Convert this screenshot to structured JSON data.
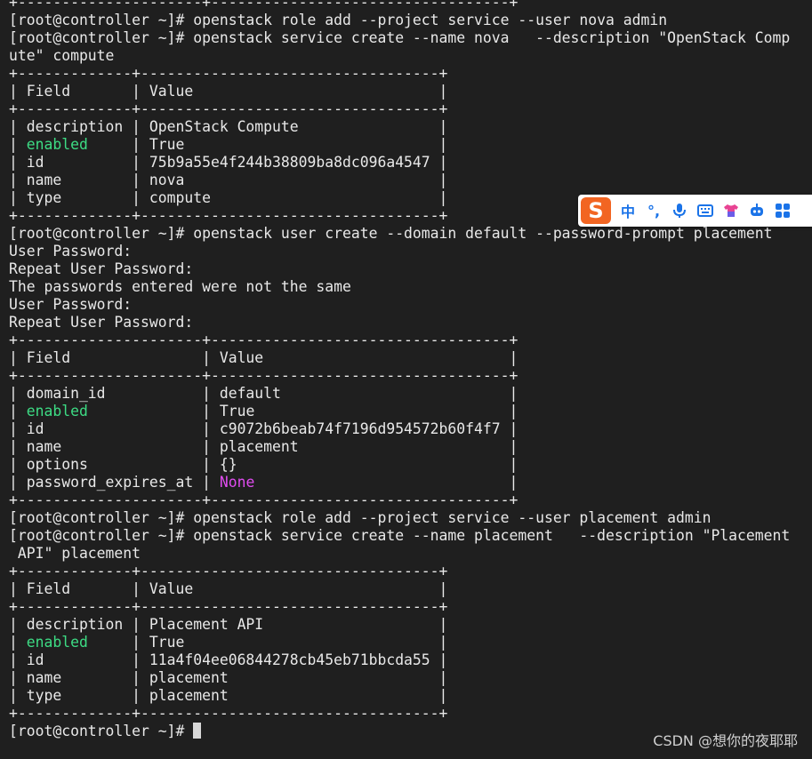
{
  "terminal": {
    "lines": [
      [
        {
          "t": "+---------------------+----------------------------------+"
        }
      ],
      [
        {
          "t": "[root@controller ~]# openstack role add --project service --user nova admin"
        }
      ],
      [
        {
          "t": "[root@controller ~]# openstack service create --name nova   --description \"OpenStack Comp"
        }
      ],
      [
        {
          "t": "ute\" compute"
        }
      ],
      [
        {
          "t": "+-------------+----------------------------------+"
        }
      ],
      [
        {
          "t": "| Field       | Value                            |"
        }
      ],
      [
        {
          "t": "+-------------+----------------------------------+"
        }
      ],
      [
        {
          "t": "| description | OpenStack Compute                |"
        }
      ],
      [
        {
          "t": "| "
        },
        {
          "t": "enabled",
          "c": "green"
        },
        {
          "t": "     | True                             |"
        }
      ],
      [
        {
          "t": "| id          | 75b9a55e4f244b38809ba8dc096a4547 |"
        }
      ],
      [
        {
          "t": "| name        | nova                             |"
        }
      ],
      [
        {
          "t": "| type        | compute                          |"
        }
      ],
      [
        {
          "t": "+-------------+----------------------------------+"
        }
      ],
      [
        {
          "t": "[root@controller ~]# openstack user create --domain default --password-prompt placement"
        }
      ],
      [
        {
          "t": "User Password:"
        }
      ],
      [
        {
          "t": "Repeat User Password:"
        }
      ],
      [
        {
          "t": "The passwords entered were not the same"
        }
      ],
      [
        {
          "t": "User Password:"
        }
      ],
      [
        {
          "t": "Repeat User Password:"
        }
      ],
      [
        {
          "t": "+---------------------+----------------------------------+"
        }
      ],
      [
        {
          "t": "| Field               | Value                            |"
        }
      ],
      [
        {
          "t": "+---------------------+----------------------------------+"
        }
      ],
      [
        {
          "t": "| domain_id           | default                          |"
        }
      ],
      [
        {
          "t": "| "
        },
        {
          "t": "enabled",
          "c": "green"
        },
        {
          "t": "             | True                             |"
        }
      ],
      [
        {
          "t": "| id                  | c9072b6beab74f7196d954572b60f4f7 |"
        }
      ],
      [
        {
          "t": "| name                | placement                        |"
        }
      ],
      [
        {
          "t": "| options             | {}                               |"
        }
      ],
      [
        {
          "t": "| password_expires_at | "
        },
        {
          "t": "None",
          "c": "magenta"
        },
        {
          "t": "                             |"
        }
      ],
      [
        {
          "t": "+---------------------+----------------------------------+"
        }
      ],
      [
        {
          "t": "[root@controller ~]# openstack role add --project service --user placement admin"
        }
      ],
      [
        {
          "t": "[root@controller ~]# openstack service create --name placement   --description \"Placement"
        }
      ],
      [
        {
          "t": " API\" placement"
        }
      ],
      [
        {
          "t": "+-------------+----------------------------------+"
        }
      ],
      [
        {
          "t": "| Field       | Value                            |"
        }
      ],
      [
        {
          "t": "+-------------+----------------------------------+"
        }
      ],
      [
        {
          "t": "| description | Placement API                    |"
        }
      ],
      [
        {
          "t": "| "
        },
        {
          "t": "enabled",
          "c": "green"
        },
        {
          "t": "     | True                             |"
        }
      ],
      [
        {
          "t": "| id          | 11a4f04ee06844278cb45eb71bbcda55 |"
        }
      ],
      [
        {
          "t": "| name        | placement                        |"
        }
      ],
      [
        {
          "t": "| type        | placement                        |"
        }
      ],
      [
        {
          "t": "+-------------+----------------------------------+"
        }
      ],
      [
        {
          "t": "[root@controller ~]# "
        }
      ]
    ]
  },
  "ime_toolbar": {
    "logo_letter": "S",
    "items": [
      {
        "label": "中",
        "name": "chinese-mode-toggle"
      },
      {
        "label": "°,",
        "name": "punctuation-toggle"
      },
      {
        "icon": "microphone-icon"
      },
      {
        "icon": "keyboard-icon"
      },
      {
        "icon": "skin-icon"
      },
      {
        "icon": "robot-icon"
      },
      {
        "icon": "grid-icon"
      }
    ]
  },
  "watermark": "CSDN @想你的夜耶耶",
  "colors": {
    "background": "#1f1f1f",
    "text": "#e8e8e8",
    "green": "#3ddc84",
    "magenta": "#e04cf0",
    "ime_accent": "#1a73e8",
    "ime_logo": "#f26522"
  }
}
